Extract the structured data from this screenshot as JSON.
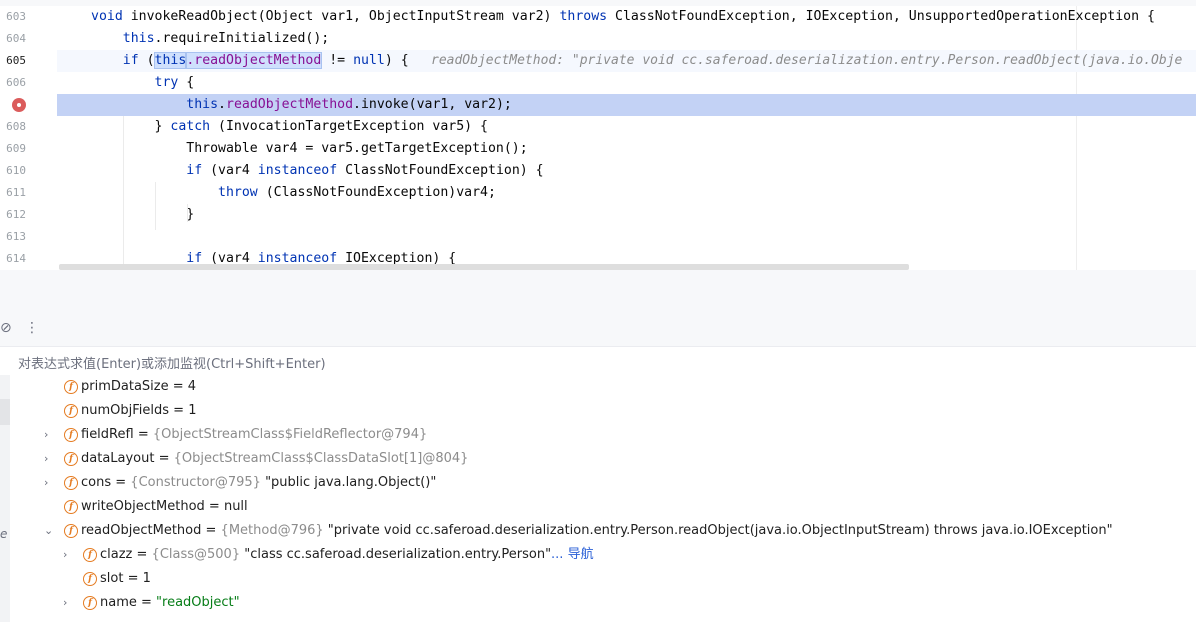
{
  "editor": {
    "lines": [
      {
        "num": "603",
        "segs": [
          {
            "t": "void ",
            "c": "kw"
          },
          {
            "t": "invokeReadObject(Object var1, ObjectInputStream var2) "
          },
          {
            "t": "throws ",
            "c": "kw"
          },
          {
            "t": "ClassNotFoundException, IOException, UnsupportedOperationException {"
          }
        ]
      },
      {
        "num": "604",
        "segs": [
          {
            "t": "    "
          },
          {
            "t": "this",
            "c": "kw"
          },
          {
            "t": ".requireInitialized();"
          }
        ]
      },
      {
        "num": "605",
        "segs": [
          {
            "t": "    "
          },
          {
            "t": "if ",
            "c": "kw"
          },
          {
            "t": "("
          },
          {
            "t": "this",
            "c": "kw sel"
          },
          {
            "t": ".readObjectMethod",
            "c": "fld sel"
          },
          {
            "t": " != "
          },
          {
            "t": "null",
            "c": "kw"
          },
          {
            "t": ") {"
          }
        ]
      },
      {
        "num": "606",
        "segs": [
          {
            "t": "        "
          },
          {
            "t": "try ",
            "c": "kw"
          },
          {
            "t": "{"
          }
        ]
      },
      {
        "num": "",
        "segs": [
          {
            "t": "            "
          },
          {
            "t": "this",
            "c": "kw"
          },
          {
            "t": "."
          },
          {
            "t": "readObjectMethod",
            "c": "fld"
          },
          {
            "t": ".invoke(var1, var2);"
          }
        ]
      },
      {
        "num": "608",
        "segs": [
          {
            "t": "        } "
          },
          {
            "t": "catch ",
            "c": "kw"
          },
          {
            "t": "(InvocationTargetException var5) {"
          }
        ]
      },
      {
        "num": "609",
        "segs": [
          {
            "t": "            Throwable var4 = var5.getTargetException();"
          }
        ]
      },
      {
        "num": "610",
        "segs": [
          {
            "t": "            "
          },
          {
            "t": "if ",
            "c": "kw"
          },
          {
            "t": "(var4 "
          },
          {
            "t": "instanceof ",
            "c": "kw"
          },
          {
            "t": "ClassNotFoundException) {"
          }
        ]
      },
      {
        "num": "611",
        "segs": [
          {
            "t": "                "
          },
          {
            "t": "throw ",
            "c": "kw"
          },
          {
            "t": "(ClassNotFoundException)var4;"
          }
        ]
      },
      {
        "num": "612",
        "segs": [
          {
            "t": "            }"
          }
        ]
      },
      {
        "num": "613",
        "segs": []
      },
      {
        "num": "614",
        "segs": [
          {
            "t": "            "
          },
          {
            "t": "if ",
            "c": "kw"
          },
          {
            "t": "(var4 "
          },
          {
            "t": "instanceof ",
            "c": "kw"
          },
          {
            "t": "IOException) {"
          }
        ]
      }
    ],
    "inlay_hint": "readObjectMethod: \"private void cc.saferoad.deserialization.entry.Person.readObject(java.io.Obje"
  },
  "evaluate": {
    "placeholder": "对表达式求值(Enter)或添加监视(Ctrl+Shift+Enter)"
  },
  "variables": [
    {
      "indent": 0,
      "arrow": "",
      "name": "primDataSize",
      "sep": " = ",
      "ref": "",
      "value": "4",
      "value_kind": "plain",
      "link": ""
    },
    {
      "indent": 0,
      "arrow": "",
      "name": "numObjFields",
      "sep": " = ",
      "ref": "",
      "value": "1",
      "value_kind": "plain",
      "link": ""
    },
    {
      "indent": 0,
      "arrow": "›",
      "name": "fieldRefl",
      "sep": " = ",
      "ref": "{ObjectStreamClass$FieldReflector@794}",
      "value": "",
      "value_kind": "plain",
      "link": ""
    },
    {
      "indent": 0,
      "arrow": "›",
      "name": "dataLayout",
      "sep": " = ",
      "ref": "{ObjectStreamClass$ClassDataSlot[1]@804}",
      "value": "",
      "value_kind": "plain",
      "link": ""
    },
    {
      "indent": 0,
      "arrow": "›",
      "name": "cons",
      "sep": " = ",
      "ref": "{Constructor@795} ",
      "value": "\"public java.lang.Object()\"",
      "value_kind": "plain",
      "link": ""
    },
    {
      "indent": 0,
      "arrow": "",
      "name": "writeObjectMethod",
      "sep": " = ",
      "ref": "",
      "value": "null",
      "value_kind": "plain",
      "link": ""
    },
    {
      "indent": 0,
      "arrow": "⌄",
      "name": "readObjectMethod",
      "sep": " = ",
      "ref": "{Method@796} ",
      "value": "\"private void cc.saferoad.deserialization.entry.Person.readObject(java.io.ObjectInputStream) throws java.io.IOException\"",
      "value_kind": "plain",
      "link": ""
    },
    {
      "indent": 1,
      "arrow": "›",
      "name": "clazz",
      "sep": " = ",
      "ref": "{Class@500} ",
      "value": "\"class cc.saferoad.deserialization.entry.Person\"",
      "value_kind": "plain",
      "link": "... 导航"
    },
    {
      "indent": 1,
      "arrow": "",
      "name": "slot",
      "sep": " = ",
      "ref": "",
      "value": "1",
      "value_kind": "plain",
      "link": ""
    },
    {
      "indent": 1,
      "arrow": "›",
      "name": "name",
      "sep": " = ",
      "ref": "",
      "value": "\"readObject\"",
      "value_kind": "str",
      "link": ""
    }
  ],
  "colors": {
    "accent": "#2a5fd6",
    "exec_line": "#c3d2f5",
    "field": "#871094",
    "keyword": "#0033b3"
  }
}
